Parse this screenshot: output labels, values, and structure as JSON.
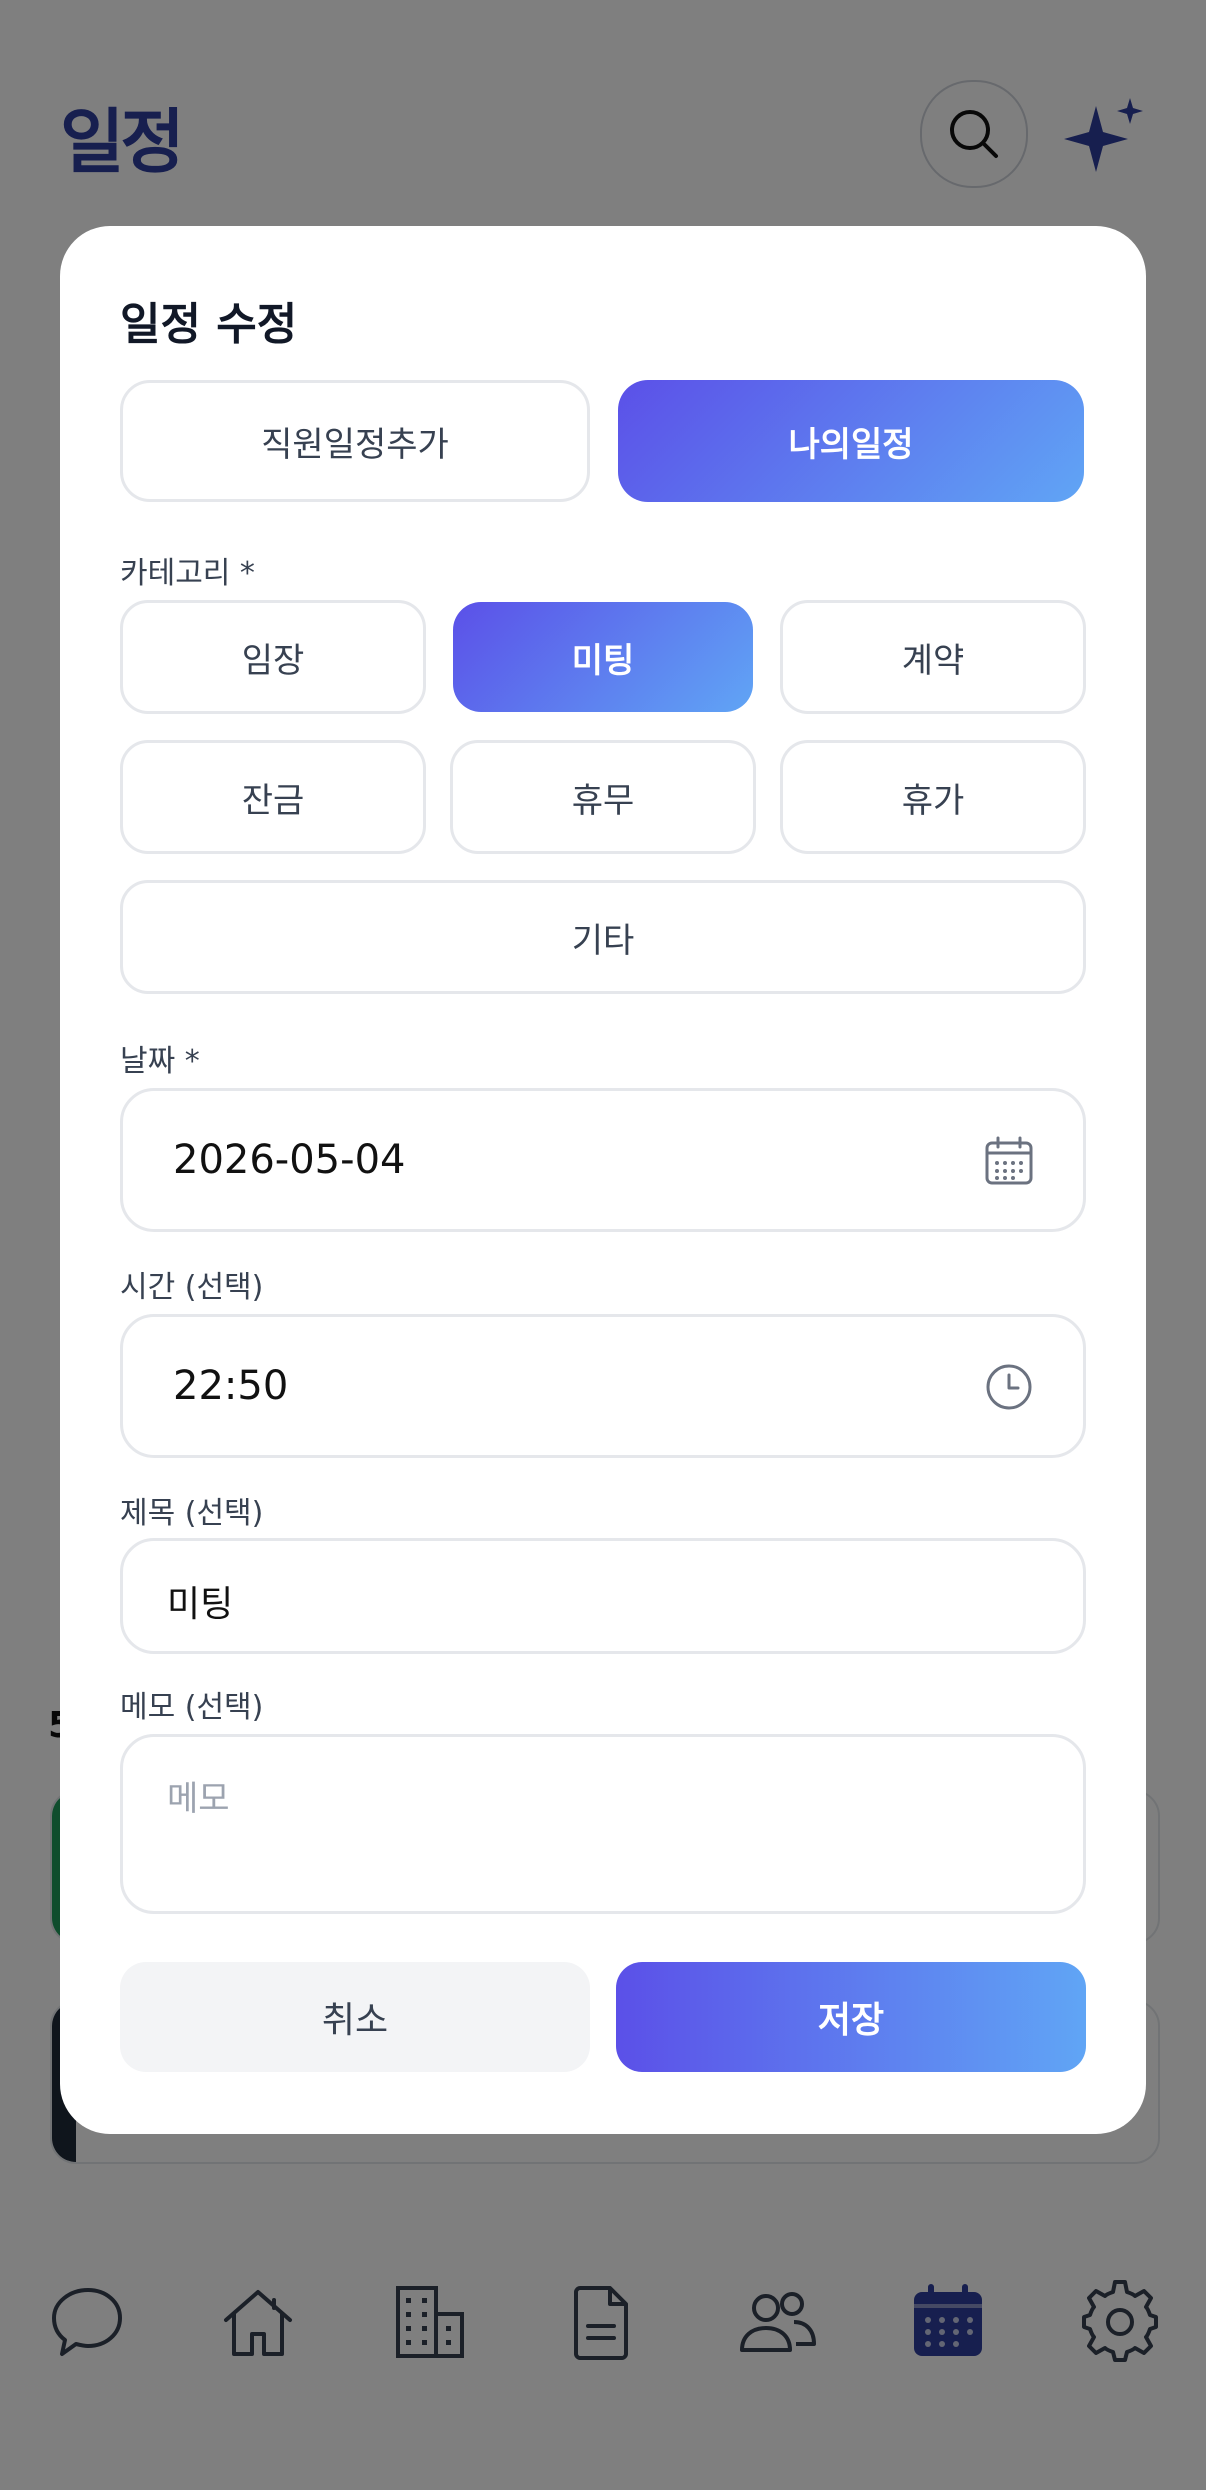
{
  "header": {
    "title": "일정"
  },
  "background": {
    "date_heading_fragment": "5"
  },
  "modal": {
    "title": "일정 수정",
    "segments": [
      {
        "label": "직원일정추가",
        "active": false
      },
      {
        "label": "나의일정",
        "active": true
      }
    ],
    "category": {
      "label": "카테고리 *",
      "options": [
        {
          "label": "임장",
          "active": false
        },
        {
          "label": "미팅",
          "active": true
        },
        {
          "label": "계약",
          "active": false
        },
        {
          "label": "잔금",
          "active": false
        },
        {
          "label": "휴무",
          "active": false
        },
        {
          "label": "휴가",
          "active": false
        },
        {
          "label": "기타",
          "active": false
        }
      ]
    },
    "date": {
      "label": "날짜 *",
      "value": "2026-05-04",
      "icon": "calendar-icon"
    },
    "time": {
      "label": "시간 (선택)",
      "value": "22:50",
      "icon": "clock-icon"
    },
    "subject": {
      "label": "제목 (선택)",
      "value": "미팅"
    },
    "memo": {
      "label": "메모 (선택)",
      "placeholder": "메모",
      "value": ""
    },
    "actions": {
      "cancel": "취소",
      "save": "저장"
    }
  },
  "nav": {
    "items": [
      {
        "icon": "chat-icon",
        "active": false
      },
      {
        "icon": "home-icon",
        "active": false
      },
      {
        "icon": "building-icon",
        "active": false
      },
      {
        "icon": "document-icon",
        "active": false
      },
      {
        "icon": "users-icon",
        "active": false
      },
      {
        "icon": "calendar-icon",
        "active": true
      },
      {
        "icon": "gear-icon",
        "active": false
      }
    ]
  },
  "colors": {
    "brand": "#2f3f9e",
    "gradient_start": "#5b50e8",
    "gradient_end": "#60a5f5",
    "overlay": "#808080"
  }
}
